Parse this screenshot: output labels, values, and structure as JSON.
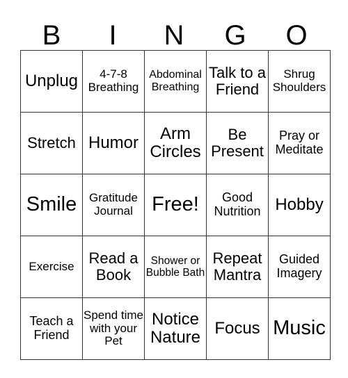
{
  "header": [
    "B",
    "I",
    "N",
    "G",
    "O"
  ],
  "rows": [
    [
      "Unplug",
      "4-7-8 Breathing",
      "Abdominal Breathing",
      "Talk to a Friend",
      "Shrug Shoulders"
    ],
    [
      "Stretch",
      "Humor",
      "Arm Circles",
      "Be Present",
      "Pray or Meditate"
    ],
    [
      "Smile",
      "Gratitude Journal",
      "Free!",
      "Good Nutrition",
      "Hobby"
    ],
    [
      "Exercise",
      "Read a Book",
      "Shower or Bubble Bath",
      "Repeat Mantra",
      "Guided Imagery"
    ],
    [
      "Teach a Friend",
      "Spend time with your Pet",
      "Notice Nature",
      "Focus",
      "Music"
    ]
  ]
}
